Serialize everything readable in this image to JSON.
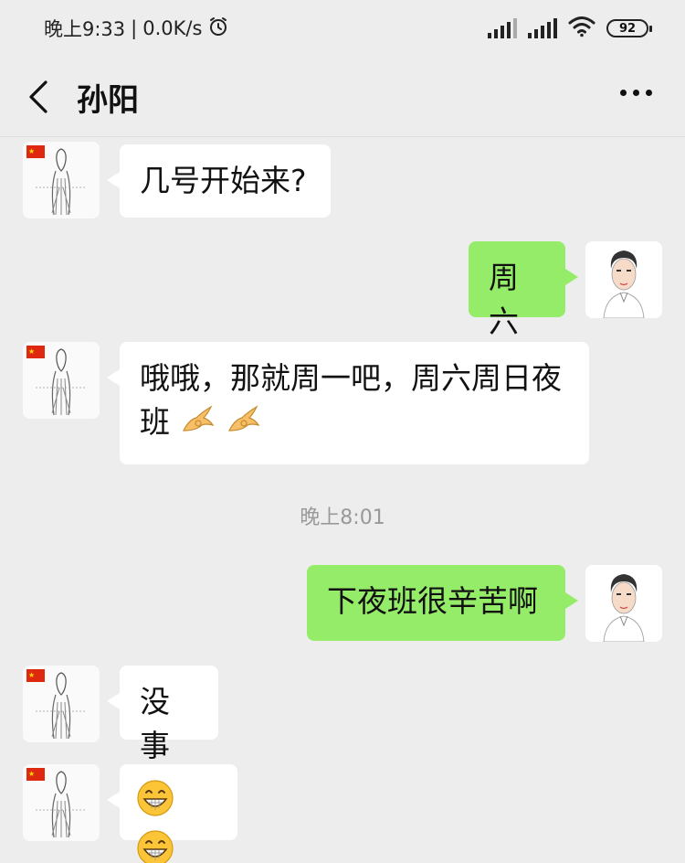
{
  "status_bar": {
    "time": "晚上9:33",
    "separator": "|",
    "net_speed": "0.0K/s",
    "alarm_icon": "alarm-clock-icon",
    "battery": "92"
  },
  "header": {
    "title": "孙阳",
    "back_icon": "chevron-left-icon",
    "more_icon": "more-dots-icon"
  },
  "messages": [
    {
      "side": "left",
      "text": "几号开始来?"
    },
    {
      "side": "right",
      "text": "周六"
    },
    {
      "side": "left",
      "text": "哦哦，那就周一吧，周六周日夜",
      "text2": "班",
      "emoji": [
        "ok-hand-emoji",
        "ok-hand-emoji"
      ]
    },
    {
      "side": "right",
      "text": "下夜班很辛苦啊"
    },
    {
      "side": "left",
      "text": "没事"
    },
    {
      "side": "left",
      "emoji": [
        "grin-emoji",
        "grin-emoji"
      ]
    }
  ],
  "timestamp": "晚上8:01",
  "colors": {
    "background": "#ededed",
    "bubble_right": "#95ec69",
    "bubble_left": "#ffffff"
  }
}
